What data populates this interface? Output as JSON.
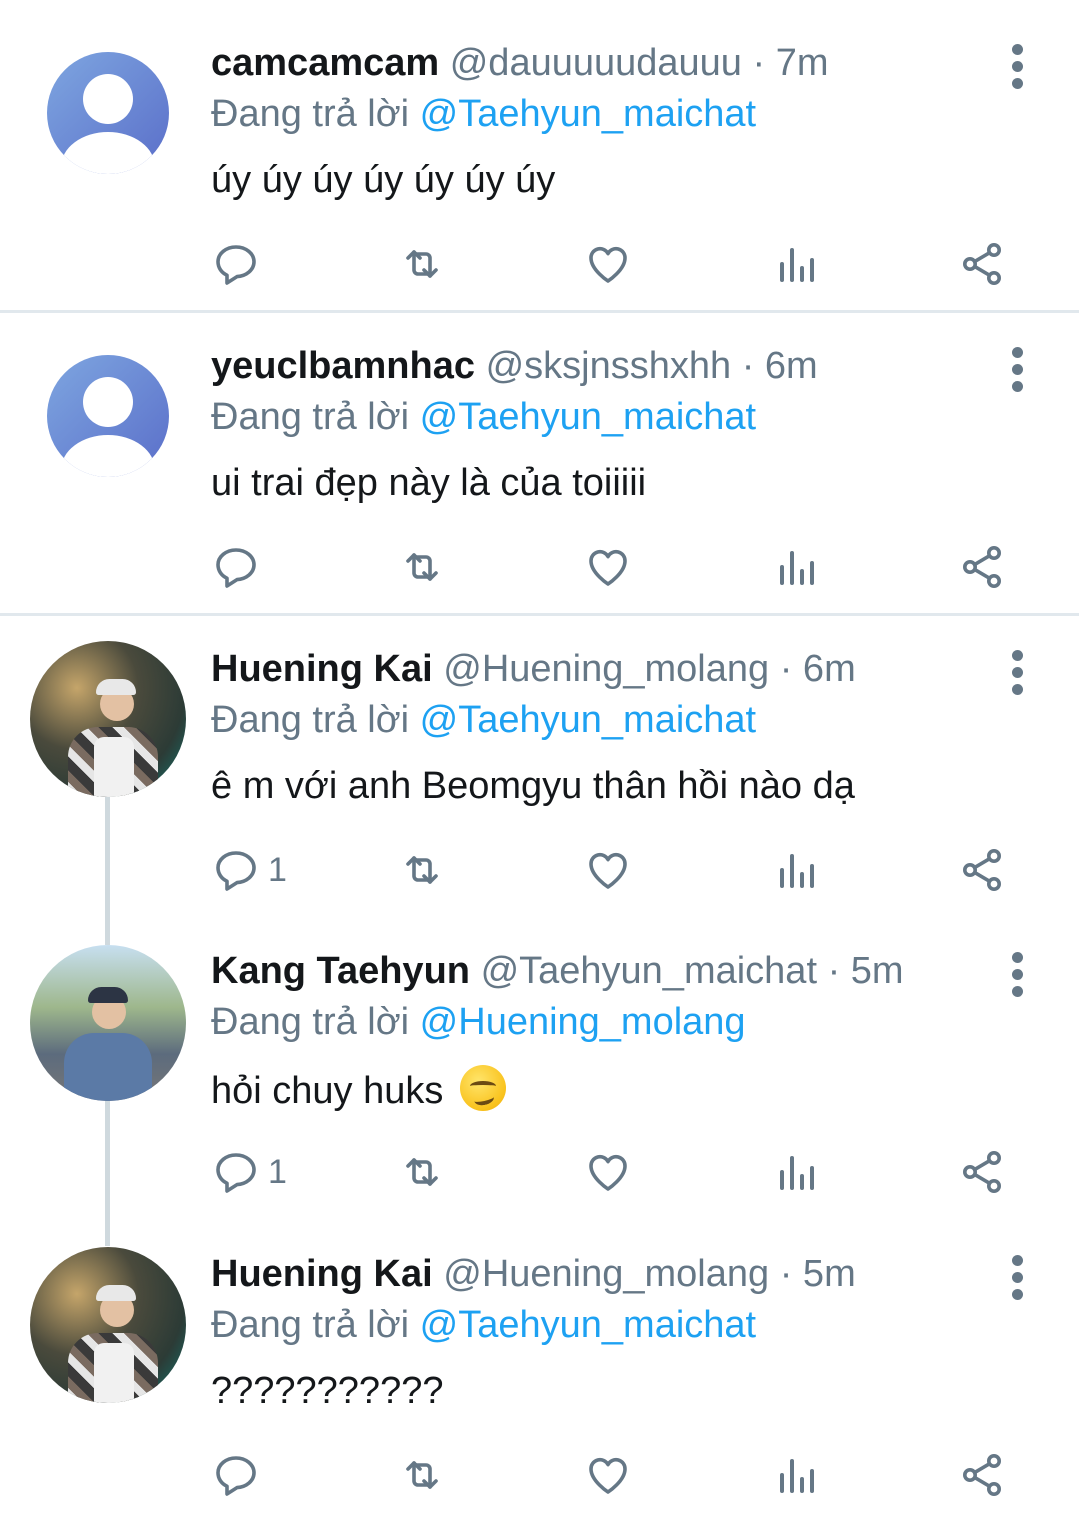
{
  "tweets": [
    {
      "name": "camcamcam",
      "handle": "@dauuuuudauuu",
      "time": "· 7m",
      "reply_prefix": "Đang trả lời",
      "reply_to": "@Taehyun_maichat",
      "text": "úy úy úy úy úy úy úy",
      "reply_count": "",
      "avatar": "default-avatar-icon"
    },
    {
      "name": "yeuclbamnhac",
      "handle": "@sksjnsshxhh",
      "time": "· 6m",
      "reply_prefix": "Đang trả lời",
      "reply_to": "@Taehyun_maichat",
      "text": "ui trai đẹp này là của toiiiii",
      "reply_count": "",
      "avatar": "default-avatar-icon"
    },
    {
      "name": "Huening Kai",
      "handle": "@Huening_molang",
      "time": "· 6m",
      "reply_prefix": "Đang trả lời",
      "reply_to": "@Taehyun_maichat",
      "text": "ê m với anh Beomgyu thân hồi nào dạ",
      "reply_count": "1",
      "avatar": "photo-avatar"
    },
    {
      "name": "Kang Taehyun",
      "handle": "@Taehyun_maichat",
      "time": "· 5m",
      "reply_prefix": "Đang trả lời",
      "reply_to": "@Huening_molang",
      "text": "hỏi chuy huks",
      "emoji": "smirking-face",
      "reply_count": "1",
      "avatar": "photo-avatar"
    },
    {
      "name": "Huening Kai",
      "handle": "@Huening_molang",
      "time": "· 5m",
      "reply_prefix": "Đang trả lời",
      "reply_to": "@Taehyun_maichat",
      "text": "???????????",
      "reply_count": "",
      "avatar": "photo-avatar"
    }
  ],
  "colors": {
    "name": "#14171a",
    "secondary": "#657786",
    "mention": "#1da1f2",
    "divider": "#e1e8ed"
  },
  "icons": [
    "reply-icon",
    "retweet-icon",
    "like-icon",
    "analytics-icon",
    "share-icon",
    "more-options-icon"
  ]
}
